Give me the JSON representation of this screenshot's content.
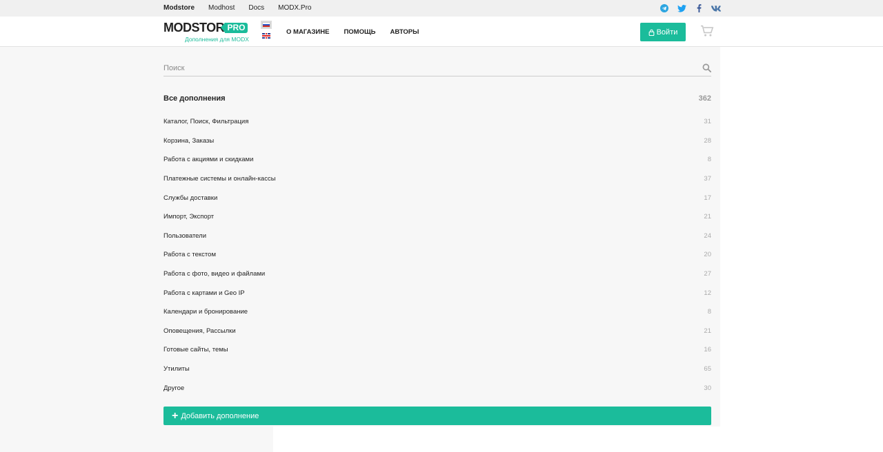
{
  "topbar": {
    "links": [
      "Modstore",
      "Modhost",
      "Docs",
      "MODX.Pro"
    ],
    "socials": [
      "telegram-icon",
      "twitter-icon",
      "facebook-icon",
      "vk-icon"
    ]
  },
  "header": {
    "logo_main": "MODSTORE",
    "logo_badge": "PRO",
    "logo_sub": "Дополнения для MODX",
    "nav": [
      "О МАГАЗИНЕ",
      "ПОМОЩЬ",
      "АВТОРЫ"
    ],
    "login_label": "Войти"
  },
  "search": {
    "placeholder": "Поиск"
  },
  "categories": {
    "all": {
      "name": "Все дополнения",
      "count": "362"
    },
    "items": [
      {
        "name": "Каталог, Поиск, Фильтрация",
        "count": "31"
      },
      {
        "name": "Корзина, Заказы",
        "count": "28"
      },
      {
        "name": "Работа с акциями и скидками",
        "count": "8"
      },
      {
        "name": "Платежные системы и онлайн-кассы",
        "count": "37"
      },
      {
        "name": "Службы доставки",
        "count": "17"
      },
      {
        "name": "Импорт, Экспорт",
        "count": "21"
      },
      {
        "name": "Пользователи",
        "count": "24"
      },
      {
        "name": "Работа с текстом",
        "count": "20"
      },
      {
        "name": "Работа с фото, видео и файлами",
        "count": "27"
      },
      {
        "name": "Работа с картами и Geo IP",
        "count": "12"
      },
      {
        "name": "Календари и бронирование",
        "count": "8"
      },
      {
        "name": "Оповещения, Рассылки",
        "count": "21"
      },
      {
        "name": "Готовые сайты, темы",
        "count": "16"
      },
      {
        "name": "Утилиты",
        "count": "65"
      },
      {
        "name": "Другое",
        "count": "30"
      }
    ]
  },
  "add_button": {
    "label": "Добавить дополнение"
  },
  "colors": {
    "accent": "#1bbc9b",
    "telegram": "#2ca5e0",
    "twitter": "#1da1f2",
    "facebook": "#3b5998",
    "vk": "#4a76a8"
  }
}
